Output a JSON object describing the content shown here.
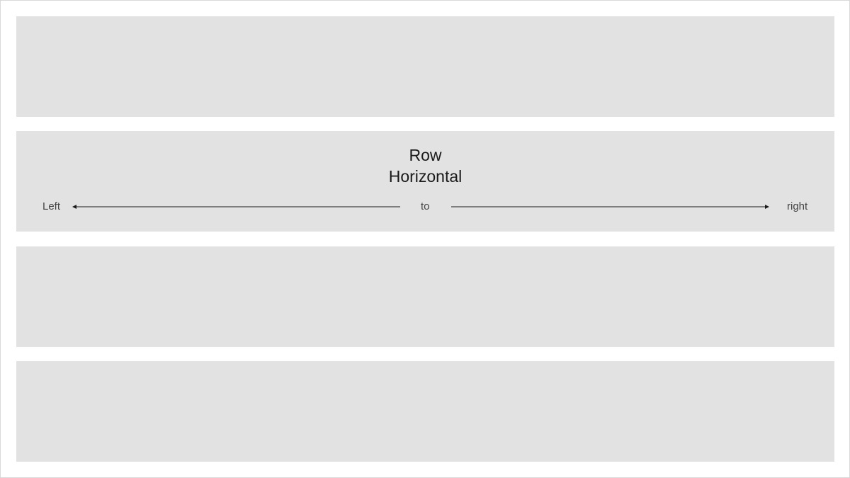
{
  "diagram": {
    "title_line_1": "Row",
    "title_line_2": "Horizontal",
    "left_label": "Left",
    "middle_label": "to",
    "right_label": "right",
    "colors": {
      "background": "#ffffff",
      "row_fill": "#e2e2e2",
      "arrow": "#1a1a1a",
      "text": "#1a1a1a"
    }
  }
}
